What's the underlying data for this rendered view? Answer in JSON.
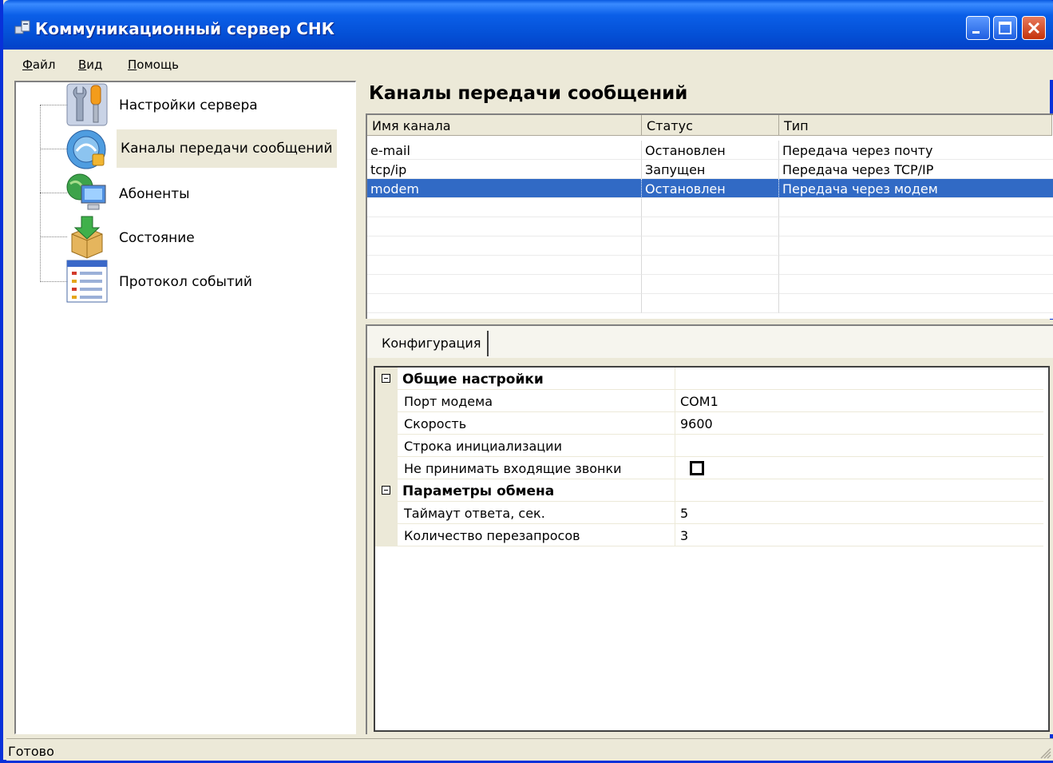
{
  "window": {
    "title": "Коммуникационный сервер СНК",
    "controls": {
      "minimize_icon": "minimize-icon",
      "maximize_icon": "maximize-icon",
      "close_icon": "close-icon"
    }
  },
  "menu": [
    {
      "first": "Ф",
      "rest": "айл"
    },
    {
      "first": "В",
      "rest": "ид"
    },
    {
      "first": "П",
      "rest": "омощь"
    }
  ],
  "tree": {
    "items": [
      {
        "label": "Настройки сервера",
        "icon": "tools-icon"
      },
      {
        "label": "Каналы передачи сообщений",
        "icon": "channel-icon",
        "selected": true
      },
      {
        "label": "Абоненты",
        "icon": "globe-computer-icon"
      },
      {
        "label": "Состояние",
        "icon": "package-icon"
      },
      {
        "label": "Протокол событий",
        "icon": "log-list-icon"
      }
    ]
  },
  "channels": {
    "title": "Каналы передачи сообщений",
    "columns": [
      "Имя канала",
      "Статус",
      "Тип"
    ],
    "rows": [
      [
        "e-mail",
        "Остановлен",
        "Передача через почту"
      ],
      [
        "tcp/ip",
        "Запущен",
        "Передача через TCP/IP"
      ],
      [
        "modem",
        "Остановлен",
        "Передача через модем"
      ]
    ],
    "selected_row": 2
  },
  "config": {
    "tab_label": "Конфигурация",
    "categories": [
      {
        "name": "Общие настройки",
        "props": [
          {
            "name": "Порт модема",
            "value": "COM1"
          },
          {
            "name": "Скорость",
            "value": "9600"
          },
          {
            "name": "Строка инициализации",
            "value": ""
          },
          {
            "name": "Не принимать входящие звонки",
            "checkbox": false
          }
        ]
      },
      {
        "name": "Параметры обмена",
        "props": [
          {
            "name": "Таймаут ответа, сек.",
            "value": "5"
          },
          {
            "name": "Количество перезапросов",
            "value": "3"
          }
        ]
      }
    ]
  },
  "status": {
    "text": "Готово"
  },
  "colors": {
    "titlebar": "#0450d6",
    "selection": "#316ac5",
    "face": "#ece9d8"
  }
}
